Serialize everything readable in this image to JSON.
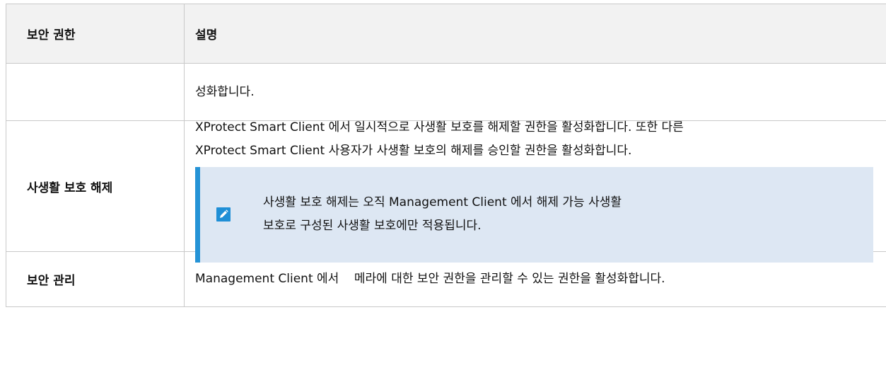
{
  "header": {
    "col1": "보안 권한",
    "col2": "설명"
  },
  "rows": [
    {
      "permission": "",
      "description": "성화합니다."
    },
    {
      "permission": "사생활 보호 해제",
      "description_lines": [
        "XProtect Smart Client 에서 일시적으로 사생활 보호를 해제할 권한을 활성화합니다. 또한 다른",
        "XProtect Smart Client 사용자가 사생활 보호의 해제를 승인할 권한을 활성화합니다."
      ],
      "note": {
        "icon": "pencil-icon",
        "lines": [
          "사생활 보호 해제는 오직 Management Client 에서 해제 가능 사생활",
          "보호로 구성된 사생활 보호에만 적용됩니다."
        ]
      }
    },
    {
      "permission": "보안 관리",
      "description": "Management Client 에서    메라에 대한 보안 권한을 관리할 수 있는 권한을 활성화합니다."
    }
  ],
  "colors": {
    "header_bg": "#f2f2f2",
    "note_bg": "#dde7f3",
    "note_accent": "#2593d6",
    "border": "#c9c9c9"
  }
}
